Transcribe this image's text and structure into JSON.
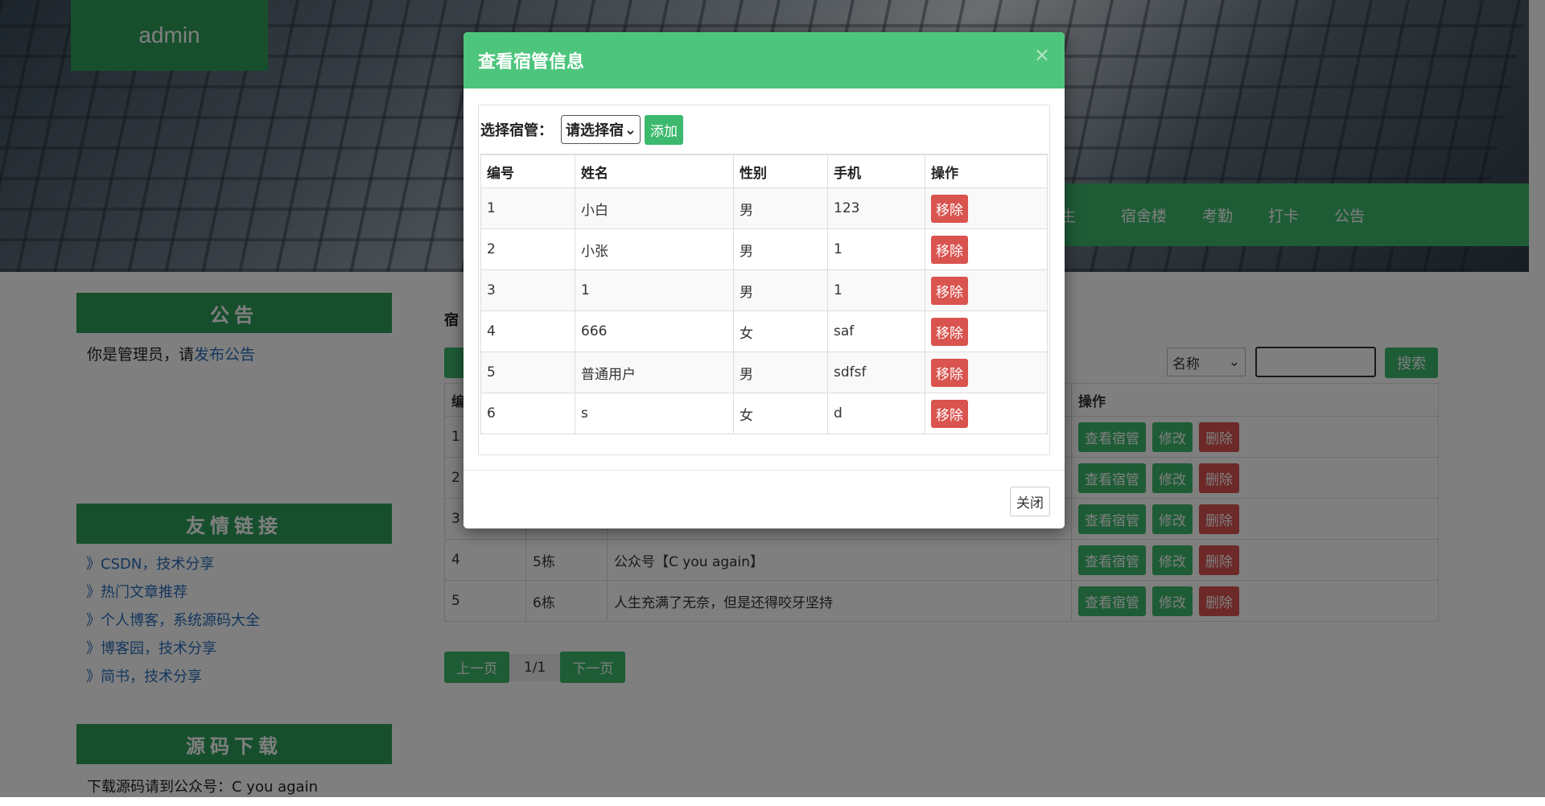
{
  "header": {
    "brand": "admin",
    "nav_items": [
      "生",
      "宿舍楼",
      "考勤",
      "打卡",
      "公告"
    ]
  },
  "sidebar": {
    "notice": {
      "title": "公告",
      "text_prefix": "你是管理员，请",
      "link_text": "发布公告"
    },
    "links": {
      "title": "友情链接",
      "items": [
        "》CSDN，技术分享",
        "》热门文章推荐",
        "》个人博客，系统源码大全",
        "》博客园，技术分享",
        "》简书，技术分享"
      ]
    },
    "download": {
      "title": "源码下载",
      "text": "下载源码请到公众号：C you again"
    }
  },
  "main": {
    "title": "宿",
    "search": {
      "select_value": "名称",
      "button": "搜索"
    },
    "table": {
      "header_first": "编",
      "header_action": "操作",
      "rows": [
        {
          "id": "1",
          "building": "",
          "desc": ""
        },
        {
          "id": "2",
          "building": "",
          "desc": ""
        },
        {
          "id": "3",
          "building": "",
          "desc": ""
        },
        {
          "id": "4",
          "building": "5栋",
          "desc": "公众号【C you again】"
        },
        {
          "id": "5",
          "building": "6栋",
          "desc": "人生充满了无奈，但是还得咬牙坚持"
        }
      ],
      "actions": {
        "view": "查看宿管",
        "edit": "修改",
        "delete": "删除"
      }
    },
    "pager": {
      "prev": "上一页",
      "current": "1/1",
      "next": "下一页"
    }
  },
  "modal": {
    "title": "查看宿管信息",
    "close_icon": "×",
    "pick_label": "选择宿管：",
    "pick_select": "请选择宿",
    "add_button": "添加",
    "columns": [
      "编号",
      "姓名",
      "性别",
      "手机",
      "操作"
    ],
    "rows": [
      {
        "id": "1",
        "name": "小白",
        "gender": "男",
        "phone": "123"
      },
      {
        "id": "2",
        "name": "小张",
        "gender": "男",
        "phone": "1"
      },
      {
        "id": "3",
        "name": "1",
        "gender": "男",
        "phone": "1"
      },
      {
        "id": "4",
        "name": "666",
        "gender": "女",
        "phone": "saf"
      },
      {
        "id": "5",
        "name": "普通用户",
        "gender": "男",
        "phone": "sdfsf"
      },
      {
        "id": "6",
        "name": "s",
        "gender": "女",
        "phone": "d"
      }
    ],
    "remove_label": "移除",
    "close_button": "关闭"
  },
  "colors": {
    "brand_green": "#2e9e5b",
    "accent_green": "#3cb96c",
    "danger_red": "#d9534f"
  }
}
